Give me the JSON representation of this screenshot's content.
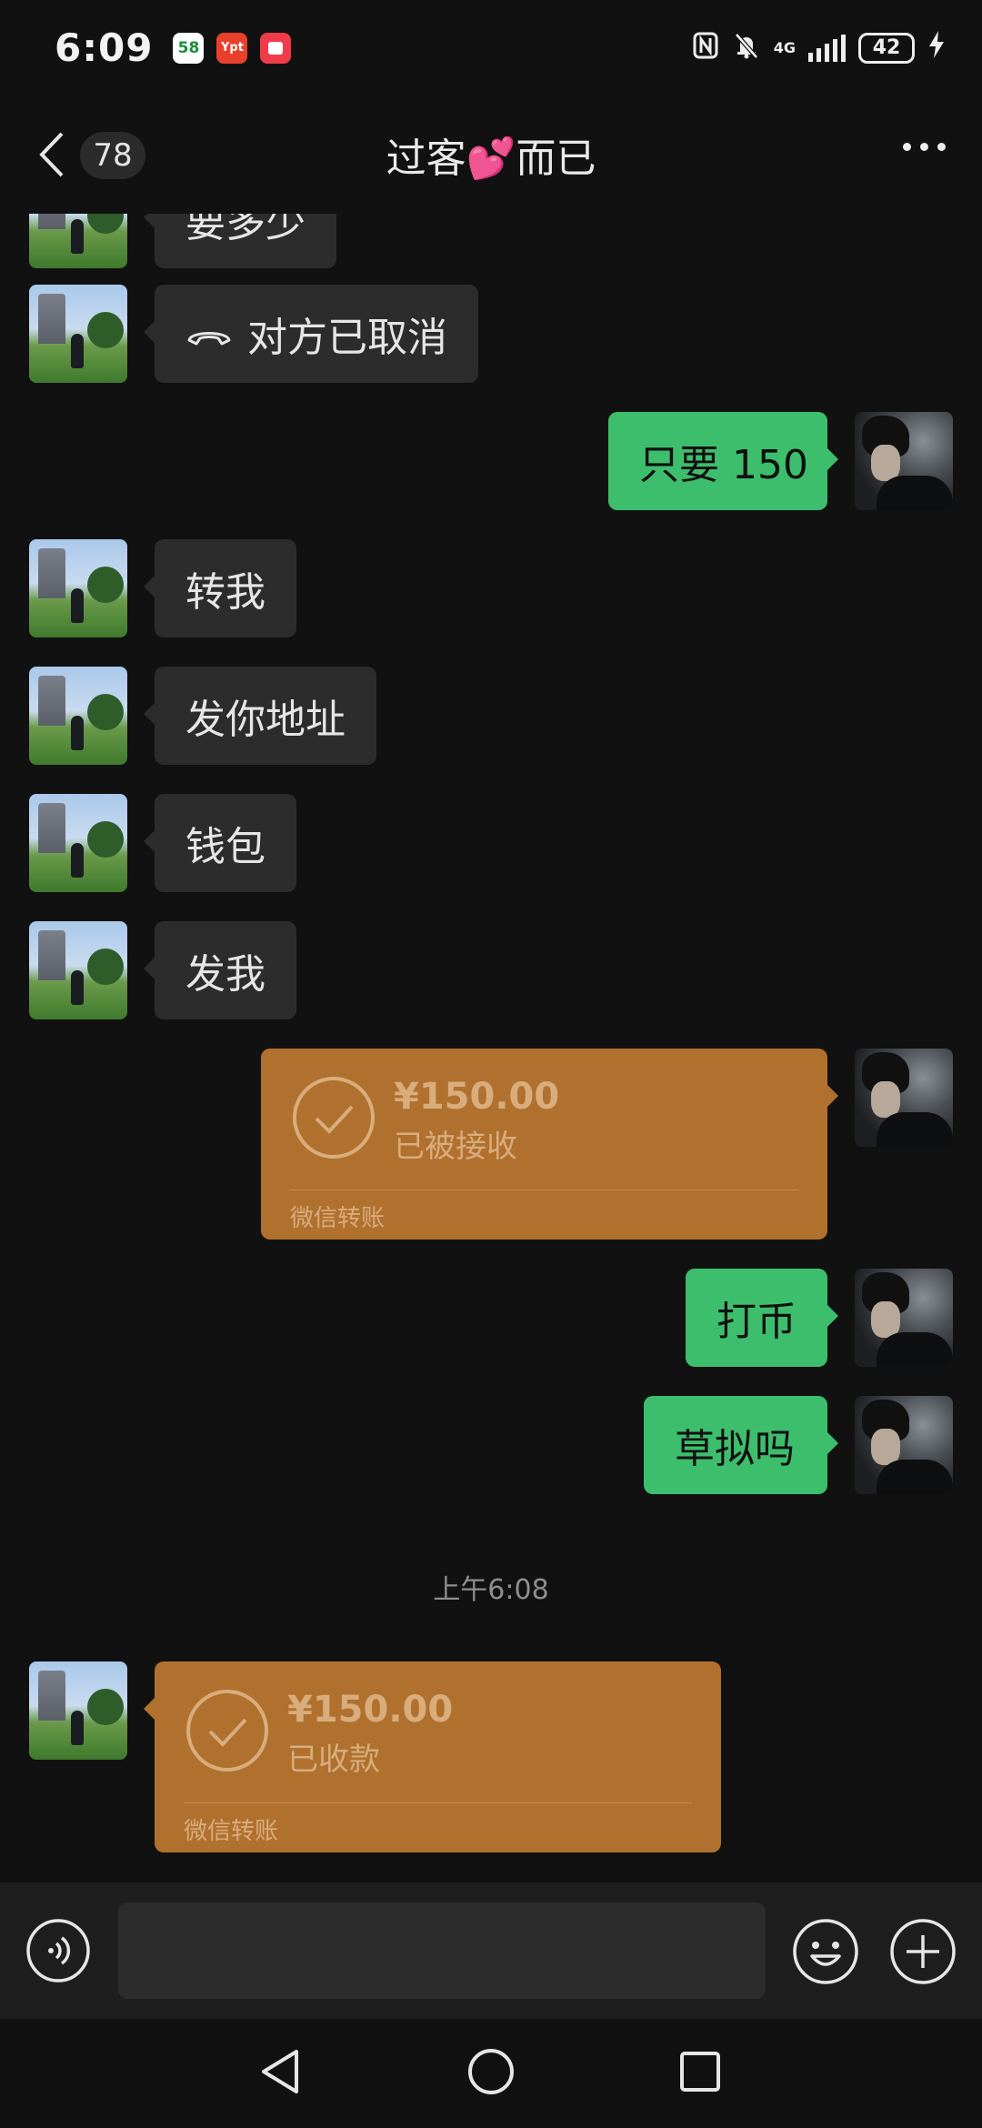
{
  "status_bar": {
    "time": "6:09",
    "notification_apps": [
      {
        "name": "58",
        "color": "#ffffff",
        "text_color": "#1a8f3c"
      },
      {
        "name": "Ypt",
        "color": "#e8402a",
        "text_color": "#ffffff"
      },
      {
        "name": "",
        "color": "#ef3b4a",
        "text_color": "#ffffff"
      }
    ],
    "network": "4G",
    "battery": "42"
  },
  "header": {
    "unread_count": "78",
    "title": "过客💕而已"
  },
  "messages": [
    {
      "side": "in",
      "type": "text",
      "text": "要多少"
    },
    {
      "side": "in",
      "type": "call",
      "text": "对方已取消"
    },
    {
      "side": "out",
      "type": "text",
      "text": "只要 150"
    },
    {
      "side": "in",
      "type": "text",
      "text": "转我"
    },
    {
      "side": "in",
      "type": "text",
      "text": "发你地址"
    },
    {
      "side": "in",
      "type": "text",
      "text": "钱包"
    },
    {
      "side": "in",
      "type": "text",
      "text": "发我"
    },
    {
      "side": "out",
      "type": "transfer",
      "amount": "¥150.00",
      "status": "已被接收",
      "footer": "微信转账"
    },
    {
      "side": "out",
      "type": "text",
      "text": "打币"
    },
    {
      "side": "out",
      "type": "text",
      "text": "草拟吗"
    },
    {
      "type": "timestamp",
      "text": "上午6:08"
    },
    {
      "side": "in",
      "type": "transfer",
      "amount": "¥150.00",
      "status": "已收款",
      "footer": "微信转账"
    }
  ],
  "input_bar": {
    "placeholder": ""
  },
  "colors": {
    "background": "#111111",
    "outgoing_bubble": "#3dbe6c",
    "incoming_bubble": "#2c2c2c",
    "transfer_card": "#b0712f"
  }
}
